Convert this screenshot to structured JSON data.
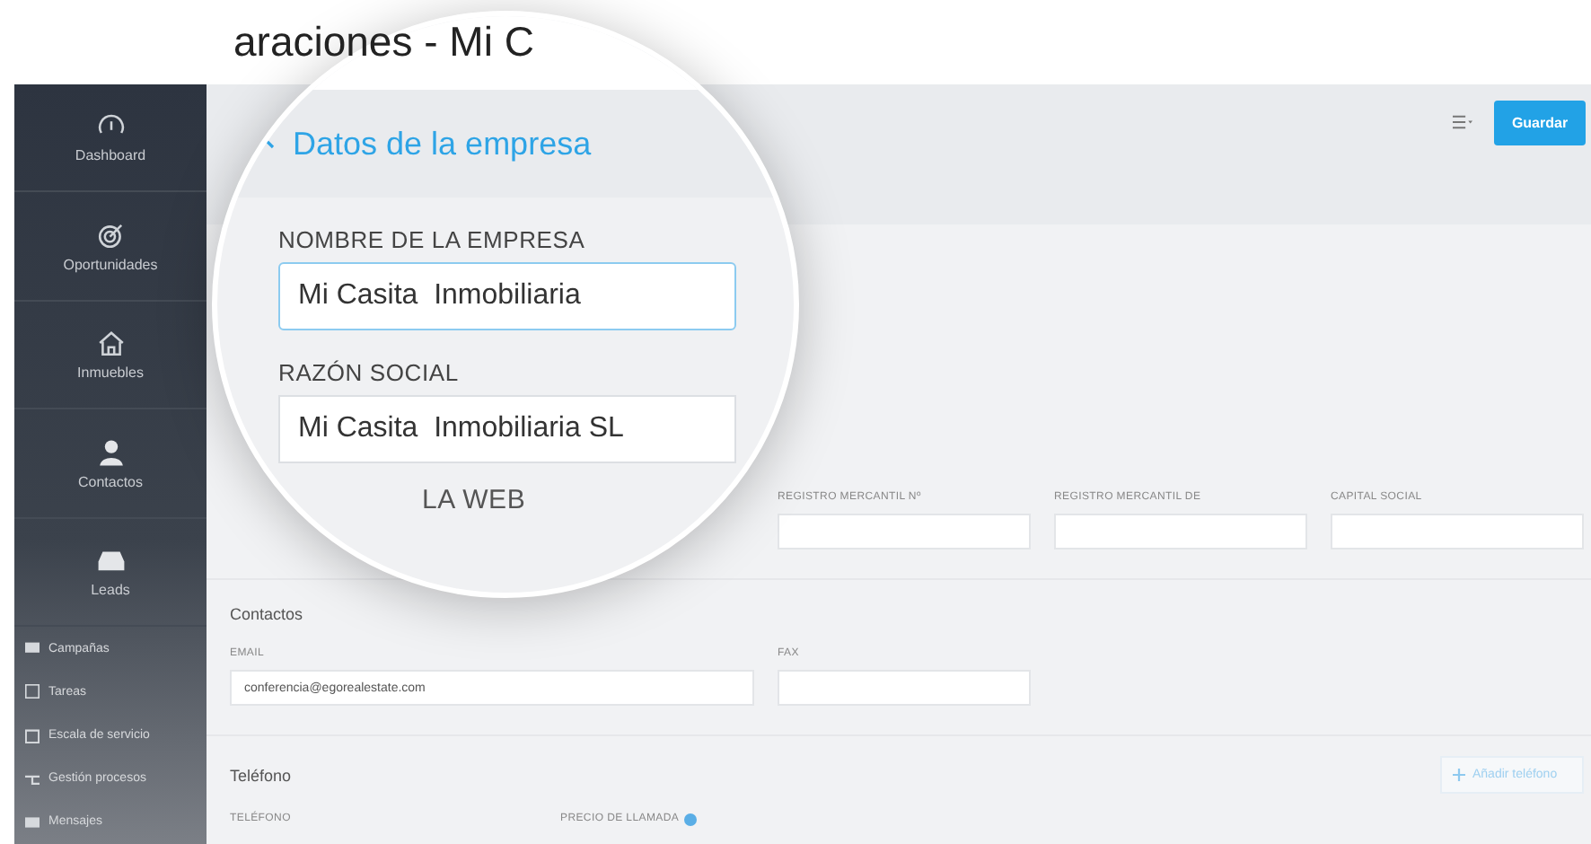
{
  "title_fragment": "araciones - Mi C",
  "sidebar": {
    "main_items": [
      {
        "label": "Dashboard"
      },
      {
        "label": "Oportunidades"
      },
      {
        "label": "Inmuebles"
      },
      {
        "label": "Contactos"
      },
      {
        "label": "Leads"
      }
    ],
    "sub_items": [
      {
        "label": "Campañas"
      },
      {
        "label": "Tareas"
      },
      {
        "label": "Escala de servicio"
      },
      {
        "label": "Gestión procesos"
      },
      {
        "label": "Mensajes"
      }
    ]
  },
  "toolbar": {
    "save_button": "Guardar"
  },
  "magnifier": {
    "section_title": "Datos de la empresa",
    "fields": [
      {
        "label": "NOMBRE DE LA EMPRESA",
        "value": "Mi Casita  Inmobiliaria",
        "focused": true
      },
      {
        "label": "RAZÓN SOCIAL",
        "value": "Mi Casita  Inmobiliaria SL",
        "focused": false
      }
    ],
    "next_section_fragment": "LA WEB"
  },
  "registry_fields": [
    {
      "label": "REGISTRO MERCANTIL Nº"
    },
    {
      "label": "REGISTRO MERCANTIL DE"
    },
    {
      "label": "CAPITAL SOCIAL"
    }
  ],
  "contacts": {
    "title": "Contactos",
    "fields": [
      {
        "label": "EMAIL",
        "value": "conferencia@egorealestate.com"
      },
      {
        "label": "FAX"
      }
    ]
  },
  "phone": {
    "title": "Teléfono",
    "add_button": "Añadir teléfono",
    "columns": [
      "TELÉFONO",
      "PRECIO DE LLAMADA"
    ]
  }
}
